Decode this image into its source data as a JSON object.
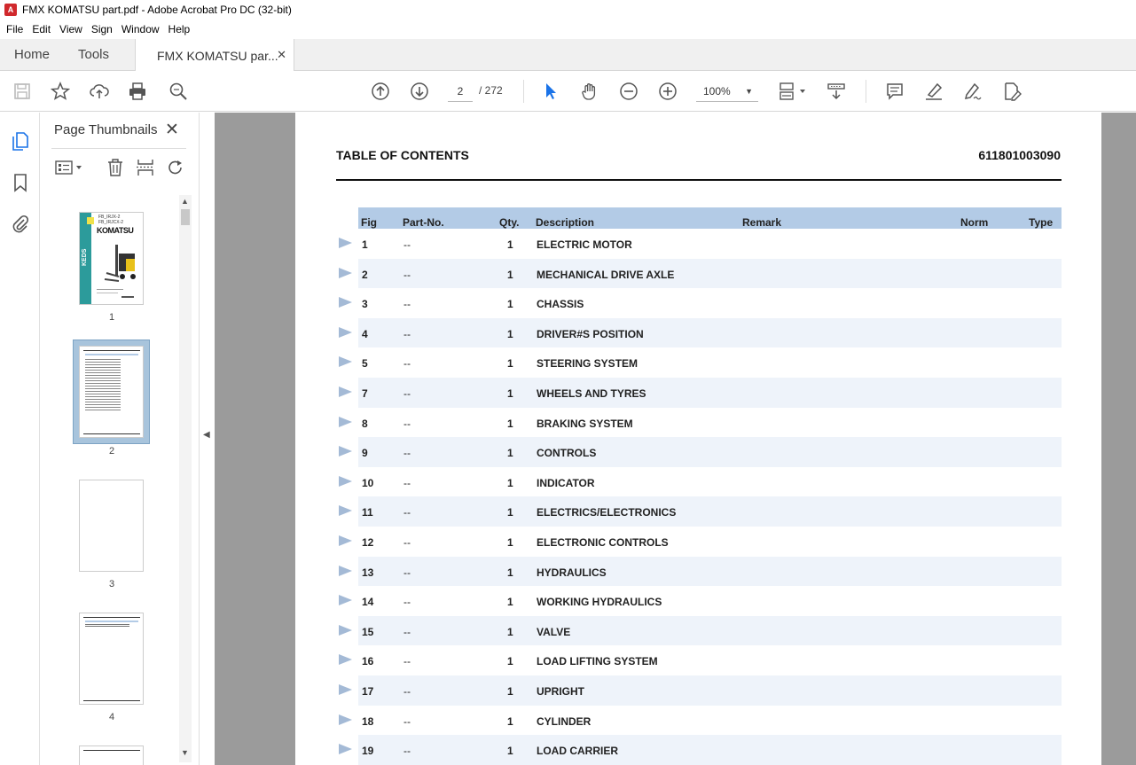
{
  "window": {
    "title": "FMX KOMATSU part.pdf - Adobe Acrobat Pro DC (32-bit)"
  },
  "menu": [
    "File",
    "Edit",
    "View",
    "Sign",
    "Window",
    "Help"
  ],
  "tabs": {
    "home": "Home",
    "tools": "Tools",
    "document": "FMX KOMATSU par...",
    "close": "✕"
  },
  "toolbar": {
    "current_page": "2",
    "total_pages": "/ 272",
    "zoom": "100%"
  },
  "thumbnails": {
    "title": "Page Thumbnails",
    "close": "✕",
    "pages": [
      "1",
      "2",
      "3",
      "4"
    ],
    "cover_model_1": "FB_IRJX-2",
    "cover_model_2": "FB_IRJCX-2",
    "cover_brand": "KOMATSU",
    "cover_side": "KEDS"
  },
  "document": {
    "heading": "TABLE OF CONTENTS",
    "number": "611801003090",
    "columns": {
      "fig": "Fig",
      "part": "Part-No.",
      "qty": "Qty.",
      "desc": "Description",
      "remark": "Remark",
      "norm": "Norm",
      "type": "Type"
    },
    "rows": [
      {
        "fig": "1",
        "part": "--",
        "qty": "1",
        "desc": "ELECTRIC MOTOR"
      },
      {
        "fig": "2",
        "part": "--",
        "qty": "1",
        "desc": "MECHANICAL DRIVE AXLE"
      },
      {
        "fig": "3",
        "part": "--",
        "qty": "1",
        "desc": "CHASSIS"
      },
      {
        "fig": "4",
        "part": "--",
        "qty": "1",
        "desc": "DRIVER#S POSITION"
      },
      {
        "fig": "5",
        "part": "--",
        "qty": "1",
        "desc": "STEERING SYSTEM"
      },
      {
        "fig": "7",
        "part": "--",
        "qty": "1",
        "desc": "WHEELS AND TYRES"
      },
      {
        "fig": "8",
        "part": "--",
        "qty": "1",
        "desc": "BRAKING SYSTEM"
      },
      {
        "fig": "9",
        "part": "--",
        "qty": "1",
        "desc": "CONTROLS"
      },
      {
        "fig": "10",
        "part": "--",
        "qty": "1",
        "desc": "INDICATOR"
      },
      {
        "fig": "11",
        "part": "--",
        "qty": "1",
        "desc": "ELECTRICS/ELECTRONICS"
      },
      {
        "fig": "12",
        "part": "--",
        "qty": "1",
        "desc": "ELECTRONIC CONTROLS"
      },
      {
        "fig": "13",
        "part": "--",
        "qty": "1",
        "desc": "HYDRAULICS"
      },
      {
        "fig": "14",
        "part": "--",
        "qty": "1",
        "desc": "WORKING HYDRAULICS"
      },
      {
        "fig": "15",
        "part": "--",
        "qty": "1",
        "desc": "VALVE"
      },
      {
        "fig": "16",
        "part": "--",
        "qty": "1",
        "desc": "LOAD LIFTING SYSTEM"
      },
      {
        "fig": "17",
        "part": "--",
        "qty": "1",
        "desc": "UPRIGHT"
      },
      {
        "fig": "18",
        "part": "--",
        "qty": "1",
        "desc": "CYLINDER"
      },
      {
        "fig": "19",
        "part": "--",
        "qty": "1",
        "desc": "LOAD CARRIER"
      }
    ]
  },
  "icons": {
    "toolbar": [
      "save-icon",
      "bookmark-star-icon",
      "upload-icon",
      "print-icon",
      "find-icon",
      "page-up-icon",
      "page-down-icon",
      "select-cursor-icon",
      "hand-icon",
      "zoom-out-icon",
      "zoom-in-icon",
      "page-fit-icon",
      "scroll-mode-icon",
      "comment-icon",
      "highlight-icon",
      "sign-icon",
      "edit-pdf-icon"
    ],
    "rail": [
      "thumbnails-icon",
      "bookmarks-icon",
      "attachments-icon"
    ]
  },
  "colors": {
    "header_row": "#b3cbe6",
    "alt_row": "#eef3fa",
    "row_marker": "#a4bad6",
    "doc_background": "#9b9b9b",
    "accent_select": "#1a73e8"
  }
}
